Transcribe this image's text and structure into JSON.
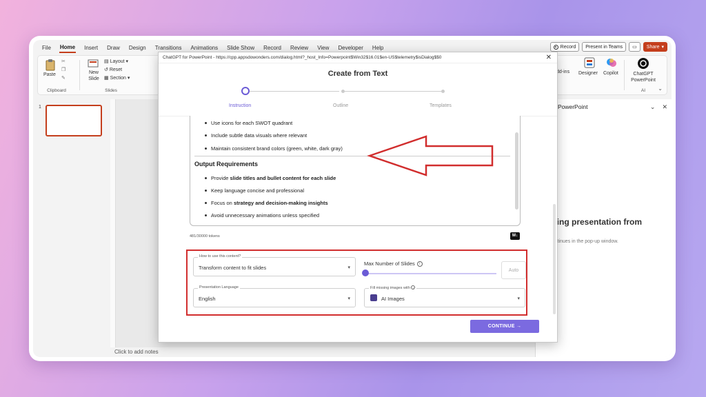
{
  "menu": [
    "File",
    "Home",
    "Insert",
    "Draw",
    "Design",
    "Transitions",
    "Animations",
    "Slide Show",
    "Record",
    "Review",
    "View",
    "Developer",
    "Help"
  ],
  "menu_active": "Home",
  "topright": {
    "record": "Record",
    "teams": "Present in Teams",
    "share": "Share"
  },
  "ribbon": {
    "paste": "Paste",
    "clipboard": "Clipboard",
    "new_slide": "New Slide",
    "layout": "Layout",
    "reset": "Reset",
    "section": "Section",
    "slides": "Slides",
    "addins": "dd-ins",
    "designer": "Designer",
    "copilot": "Copilot",
    "chatgpt": "ChatGPT PowerPoint",
    "ai": "AI"
  },
  "slides": {
    "number": "1"
  },
  "notes": "Click to add notes",
  "right_pane": {
    "title": "GPT for PowerPoint",
    "heading": "Creating presentation from text...",
    "sub": "Setup continues in the pop-up window."
  },
  "dialog": {
    "titlebar": "ChatGPT for PowerPoint - https://cpp.appsdowonders.com/dialog.html?_host_Info=Powerpoint$Win32$16.01$en-US$telemetry$isDialog$$0",
    "title": "Create from Text",
    "steps": [
      "Instruction",
      "Outline",
      "Templates"
    ],
    "active_step": "Instruction",
    "editor": {
      "top_bullets": [
        "Use icons for each SWOT quadrant",
        "Include subtle data visuals where relevant",
        "Maintain consistent brand colors (green, white, dark gray)"
      ],
      "section_heading": "Output Requirements",
      "b1_pre": "Provide ",
      "b1_bold": "slide titles and bullet content for each slide",
      "b2": "Keep language concise and professional",
      "b3_pre": "Focus on ",
      "b3_bold": "strategy and decision-making insights",
      "b4": "Avoid unnecessary animations unless specified"
    },
    "tokens": "481/30000 tokens",
    "md_icon": "M↓",
    "options": {
      "use_label": "How to use this content?",
      "use_value": "Transform content to fit slides",
      "max_slides_label": "Max Number of Slides",
      "auto": "Auto",
      "lang_label": "Presentation Language",
      "lang_value": "English",
      "images_label": "Fill missing images with",
      "images_value": "AI Images"
    },
    "continue": "CONTINUE →",
    "close": "✕"
  },
  "colors": {
    "accent": "#6b5bd6",
    "highlight": "#d12d2d",
    "brand": "#c43e1c"
  }
}
